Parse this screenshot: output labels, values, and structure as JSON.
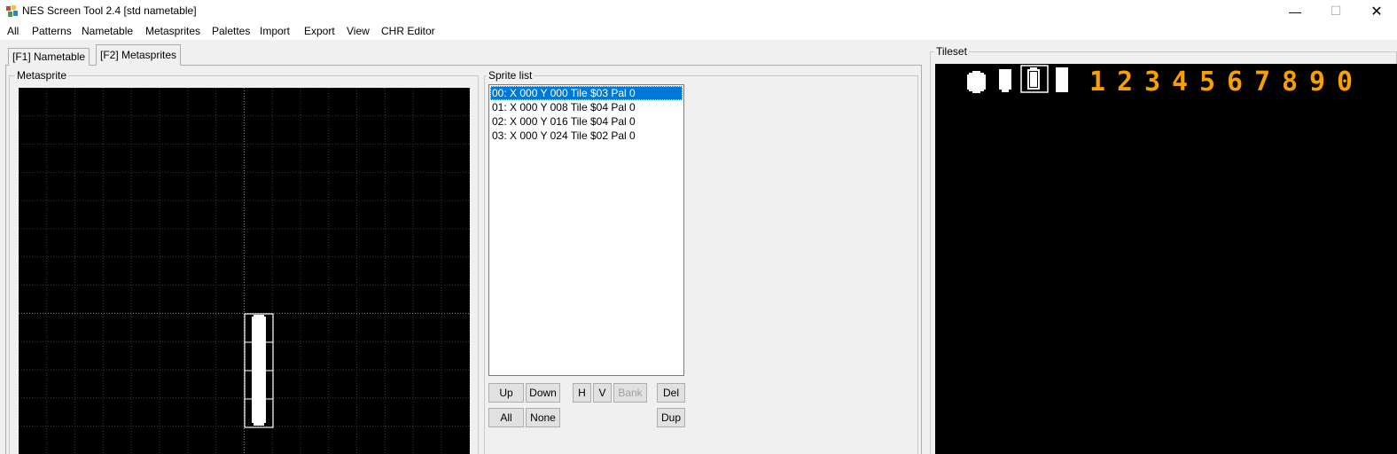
{
  "window": {
    "title": "NES Screen Tool 2.4  [std nametable]",
    "min_glyph": "—",
    "max_glyph": "☐",
    "close_glyph": "✕"
  },
  "menu": [
    "All",
    "Patterns",
    "Nametable",
    "Metasprites",
    "Palettes",
    "Import",
    "Export",
    "View",
    "CHR Editor"
  ],
  "tabs": {
    "nametable": "[F1] Nametable",
    "metasprites": "[F2] Metasprites"
  },
  "metasprite": {
    "label": "Metasprite"
  },
  "sprite_list": {
    "label": "Sprite list",
    "items": [
      "00: X 000 Y 000 Tile $03 Pal 0",
      "01: X 000 Y 008 Tile $04 Pal 0",
      "02: X 000 Y 016 Tile $04 Pal 0",
      "03: X 000 Y 024 Tile $02 Pal 0"
    ],
    "selected_index": 0
  },
  "buttons": {
    "up": "Up",
    "down": "Down",
    "h": "H",
    "v": "V",
    "bank": "Bank",
    "del": "Del",
    "all": "All",
    "none": "None",
    "dup": "Dup"
  },
  "tileset": {
    "label": "Tileset",
    "digits": "1234567890",
    "digit_color": "#f7a000"
  },
  "colors": {
    "selection": "#0078d7",
    "grid": "#3a3a3a",
    "grid_center": "#8a8a8a"
  }
}
